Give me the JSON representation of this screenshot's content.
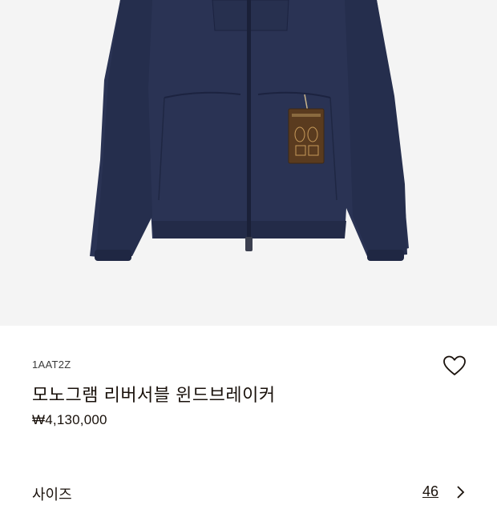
{
  "product": {
    "sku": "1AAT2Z",
    "title": "모노그램 리버서블 윈드브레이커",
    "price": "₩4,130,000"
  },
  "size_selector": {
    "label": "사이즈",
    "value": "46"
  },
  "icons": {
    "wishlist": "heart-outline-icon",
    "size_chevron": "chevron-right-icon"
  },
  "colors": {
    "jacket": "#2a3354",
    "background": "#f4f4f4",
    "text": "#19110b"
  }
}
